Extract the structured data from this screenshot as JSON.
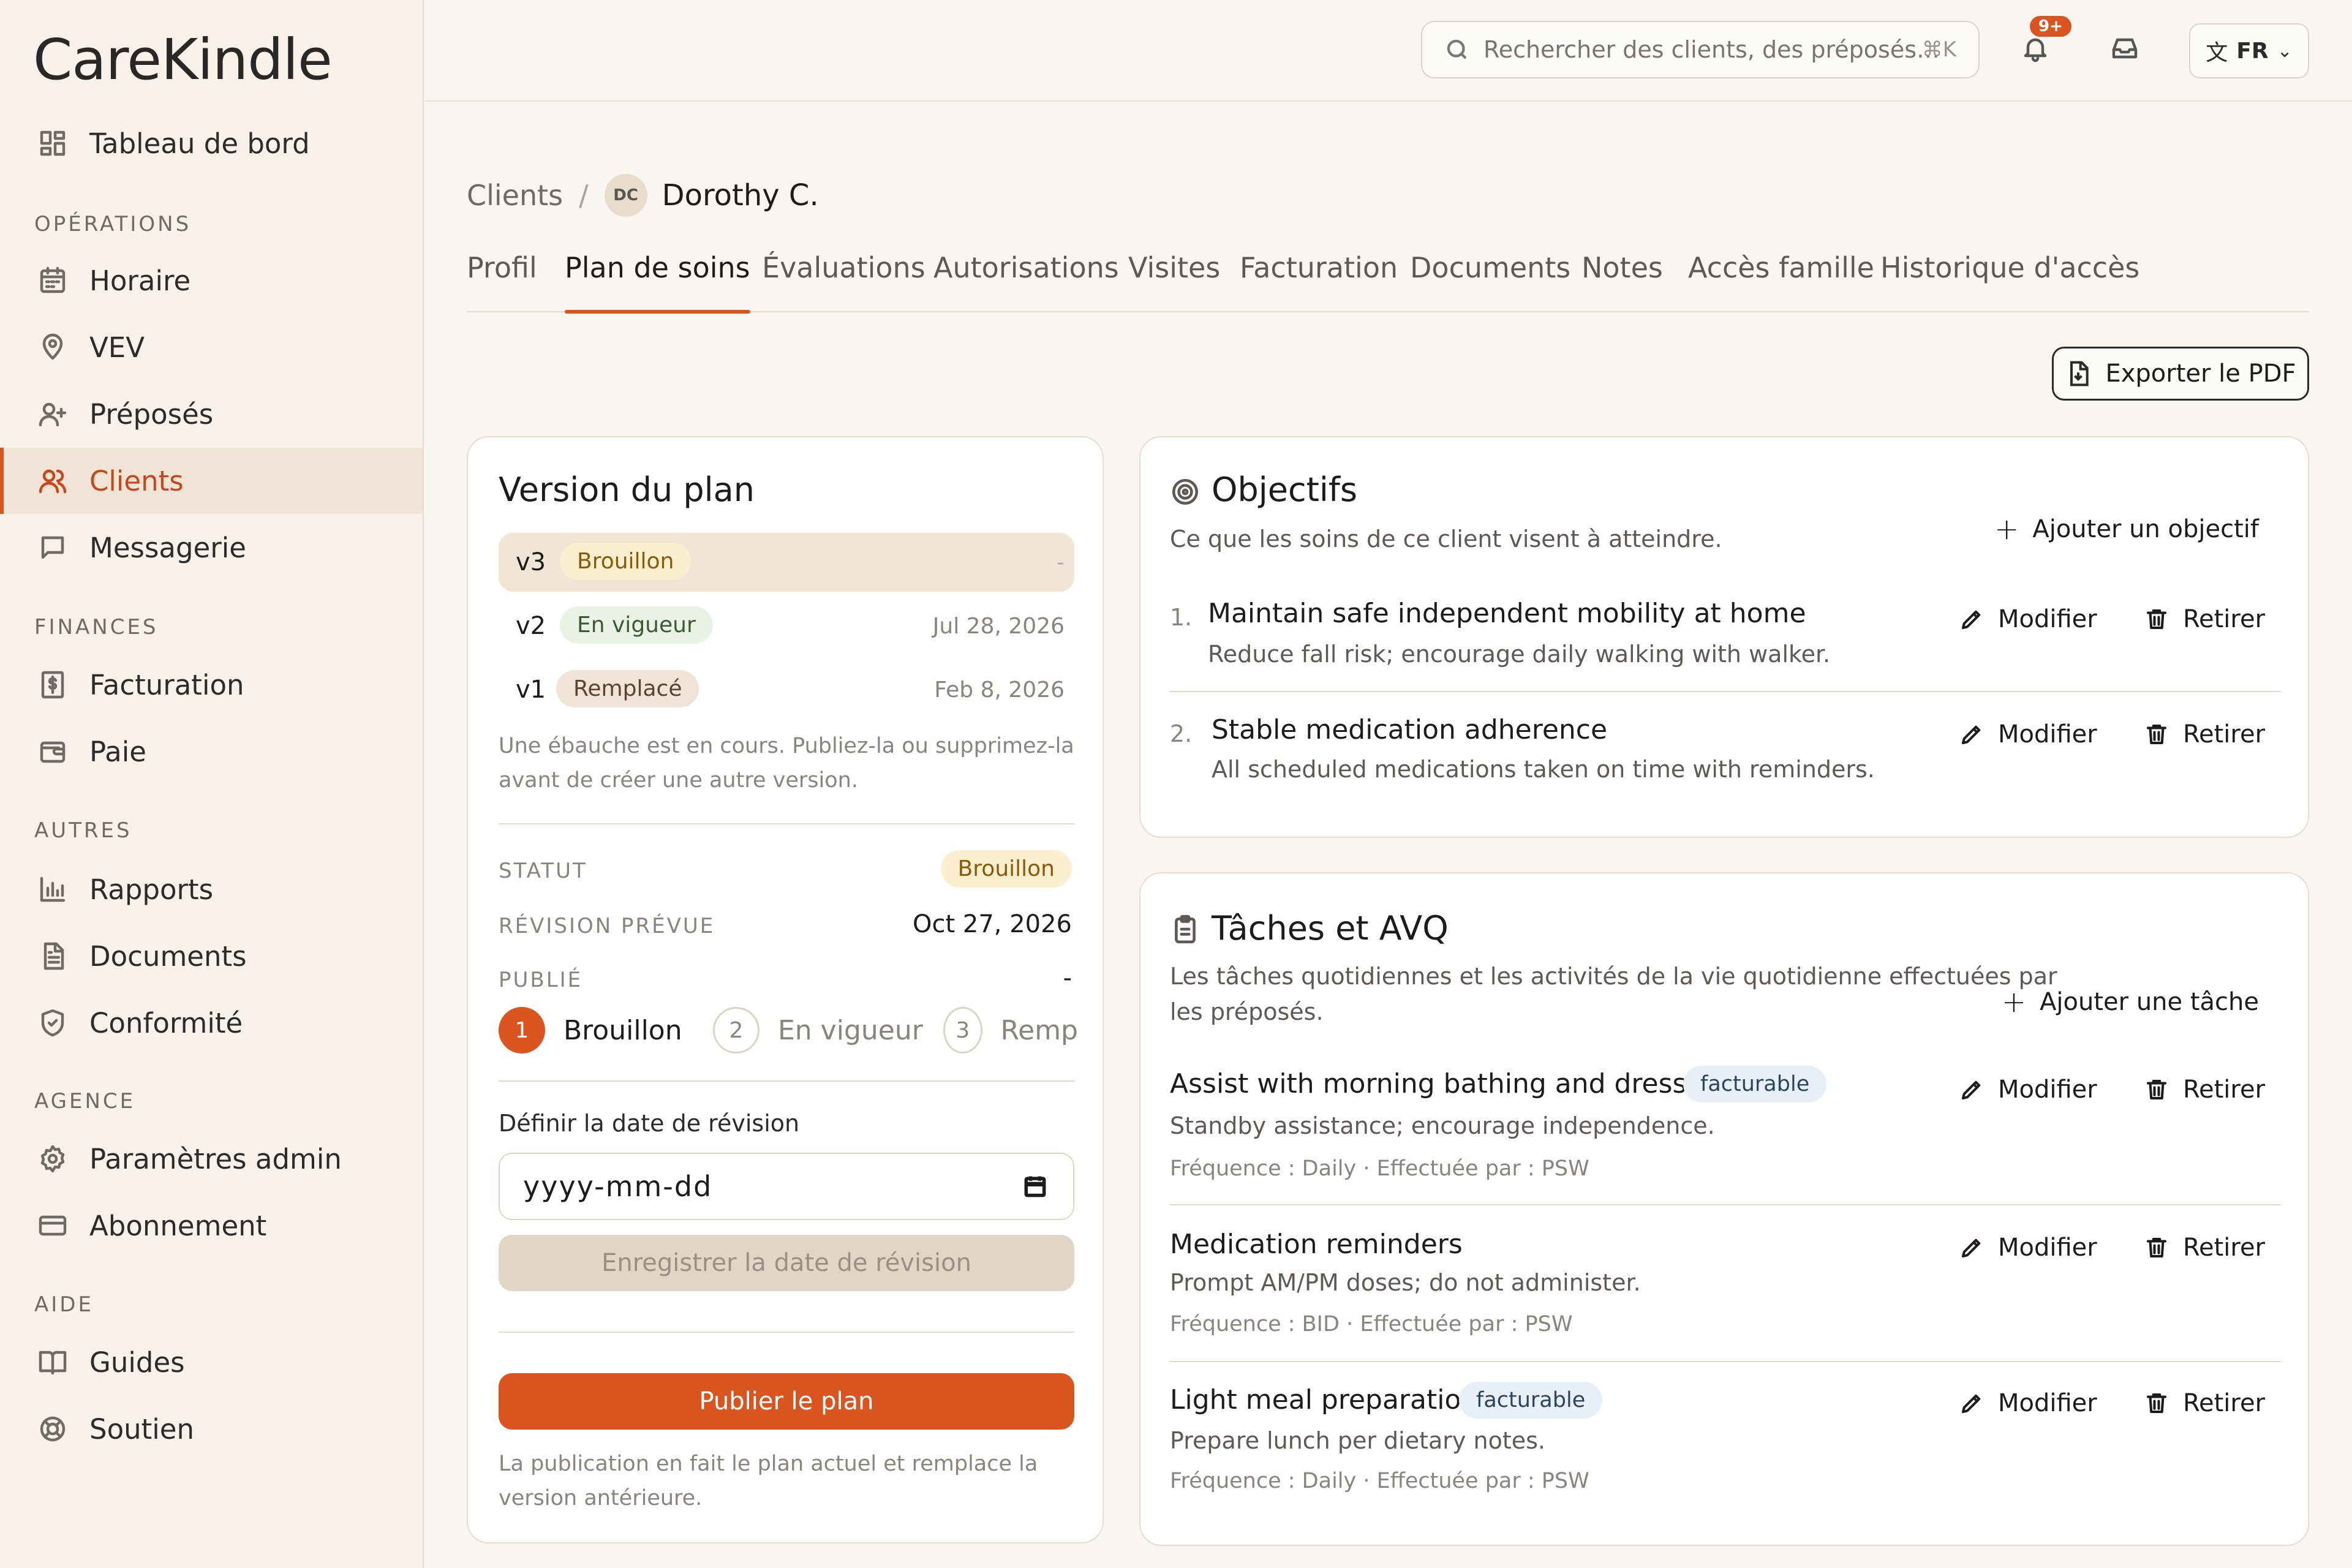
{
  "app": {
    "brand": "CareKindle"
  },
  "sidebar": {
    "dashboard": "Tableau de bord",
    "sections": {
      "operations": "OPÉRATIONS",
      "finances": "FINANCES",
      "autres": "AUTRES",
      "agence": "AGENCE",
      "aide": "AIDE"
    },
    "items": {
      "horaire": "Horaire",
      "vev": "VEV",
      "preposes": "Préposés",
      "clients": "Clients",
      "messagerie": "Messagerie",
      "facturation": "Facturation",
      "paie": "Paie",
      "rapports": "Rapports",
      "documents": "Documents",
      "conformite": "Conformité",
      "parametres": "Paramètres admin",
      "abonnement": "Abonnement",
      "guides": "Guides",
      "soutien": "Soutien"
    },
    "active": "Clients"
  },
  "topbar": {
    "search_placeholder": "Rechercher des clients, des préposés…",
    "search_shortcut": "⌘K",
    "notifications_badge": "9+",
    "language": "FR"
  },
  "breadcrumb": {
    "root": "Clients",
    "separator": "/",
    "avatar_initials": "DC",
    "client": "Dorothy C."
  },
  "tabs": [
    "Profil",
    "Plan de soins",
    "Évaluations",
    "Autorisations",
    "Visites",
    "Facturation",
    "Documents",
    "Notes",
    "Accès famille",
    "Historique d'accès"
  ],
  "active_tab": "Plan de soins",
  "export_label": "Exporter le PDF",
  "plan_version": {
    "title": "Version du plan",
    "versions": [
      {
        "name": "v3",
        "status": "Brouillon",
        "date": "-"
      },
      {
        "name": "v2",
        "status": "En vigueur",
        "date": "Jul 28, 2026"
      },
      {
        "name": "v1",
        "status": "Remplacé",
        "date": "Feb 8, 2026"
      }
    ],
    "draft_note": "Une ébauche est en cours. Publiez-la ou supprimez-la avant de créer une autre version.",
    "status_label": "STATUT",
    "status_value": "Brouillon",
    "review_label": "RÉVISION PRÉVUE",
    "review_value": "Oct 27, 2026",
    "published_label": "PUBLIÉ",
    "published_value": "-",
    "steps": [
      {
        "num": "1",
        "label": "Brouillon"
      },
      {
        "num": "2",
        "label": "En vigueur"
      },
      {
        "num": "3",
        "label": "Remp"
      }
    ],
    "review_date_label": "Définir la date de révision",
    "review_date_placeholder": "yyyy-mm-dd",
    "save_review_label": "Enregistrer la date de révision",
    "publish_label": "Publier le plan",
    "publish_note": "La publication en fait le plan actuel et remplace la version antérieure."
  },
  "objectives": {
    "title": "Objectifs",
    "subtitle": "Ce que les soins de ce client visent à atteindre.",
    "add_label": "Ajouter un objectif",
    "items": [
      {
        "num": "1.",
        "title": "Maintain safe independent mobility at home",
        "desc": "Reduce fall risk; encourage daily walking with walker."
      },
      {
        "num": "2.",
        "title": "Stable medication adherence",
        "desc": "All scheduled medications taken on time with reminders."
      }
    ]
  },
  "tasks": {
    "title": "Tâches et AVQ",
    "subtitle_line1": "Les tâches quotidiennes et les activités de la vie quotidienne effectuées par",
    "subtitle_line2": "les préposés.",
    "add_label": "Ajouter une tâche",
    "items": [
      {
        "title": "Assist with morning bathing and dressing",
        "tag": "facturable",
        "desc": "Standby assistance; encourage independence.",
        "freq": "Fréquence : Daily · Effectuée par : PSW"
      },
      {
        "title": "Medication reminders",
        "tag": "",
        "desc": "Prompt AM/PM doses; do not administer.",
        "freq": "Fréquence : BID · Effectuée par : PSW"
      },
      {
        "title": "Light meal preparation",
        "tag": "facturable",
        "desc": "Prepare lunch per dietary notes.",
        "freq": "Fréquence : Daily · Effectuée par : PSW"
      }
    ]
  },
  "actions": {
    "edit": "Modifier",
    "remove": "Retirer"
  },
  "colors": {
    "accent": "#d9541e",
    "sidebar_bg": "#f7f1ea",
    "active_bg": "#efe4d5"
  }
}
